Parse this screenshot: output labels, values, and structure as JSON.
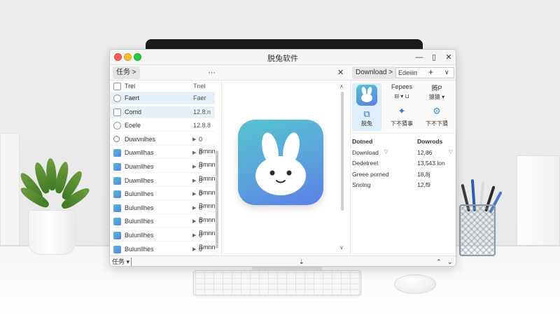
{
  "window": {
    "title": "脱兔软件",
    "minimize_glyph": "—",
    "restore_glyph": "▯",
    "close_glyph": "✕"
  },
  "toolbar": {
    "tab_label": "任务 >",
    "more_label": "···",
    "close_label": "✕",
    "download_tab_label": "Download >",
    "edit_value": "Edeiiin",
    "plus_label": "+",
    "chevron_label": "∨"
  },
  "list": {
    "header": {
      "name": "Trel",
      "status": "Tnel"
    },
    "rows": [
      {
        "icon": "circle",
        "name": "Faert",
        "status": "Faer",
        "selected": true
      },
      {
        "icon": "checkbox",
        "name": "Comd",
        "status": "12.8.n",
        "selected": true
      },
      {
        "icon": "circle",
        "name": "Eoele",
        "status": "12.8.8"
      },
      {
        "icon": "search",
        "name": "Duwvnlhes",
        "status": "0 Bmnn",
        "play": true
      },
      {
        "icon": "app",
        "name": "Duwnllhas",
        "status": "0 Bmnn",
        "play": true
      },
      {
        "icon": "app",
        "name": "Duwnllhes",
        "status": "0 Bmnn",
        "play": true
      },
      {
        "icon": "app",
        "name": "Duwnllhes",
        "status": "0 Bmnn",
        "play": true
      },
      {
        "icon": "app",
        "name": "Bulunllhes",
        "status": "0 Bmnn",
        "play": true
      },
      {
        "icon": "app",
        "name": "Bulunllhes",
        "status": "0 Bmnn",
        "play": true
      },
      {
        "icon": "app",
        "name": "Bulunllhes",
        "status": "0 Bmnn",
        "play": true
      },
      {
        "icon": "app",
        "name": "Bulunllhes",
        "status": "0 Bmnn",
        "play": true
      },
      {
        "icon": "app",
        "name": "Bulunllhes",
        "status": "0 Bmnn",
        "play": true
      }
    ]
  },
  "info": {
    "col1_label": "Fepees",
    "col2_label": "腾P",
    "col1_ctrl": "⊟ ▾",
    "col1_ctrl2": "⊔",
    "col2_ctrl": "猿猿 ▾",
    "tile1_caption": "脱兔",
    "tile2_caption": "下不猜事",
    "tile3_caption": "下不下猜",
    "rows": [
      {
        "key": "Dotned",
        "value": "Dowrods"
      },
      {
        "key": "Download",
        "value": "12,86"
      },
      {
        "key": "Dedetreet",
        "value": "13,543 lon"
      },
      {
        "key": "Greee porned",
        "value": "18,8j"
      },
      {
        "key": "Snolng",
        "value": "12,f9"
      }
    ]
  },
  "statusbar": {
    "task_label": "任务 ▾",
    "mid_glyph": "⇣",
    "up_glyph": "⌃",
    "down_glyph": "⌄"
  }
}
